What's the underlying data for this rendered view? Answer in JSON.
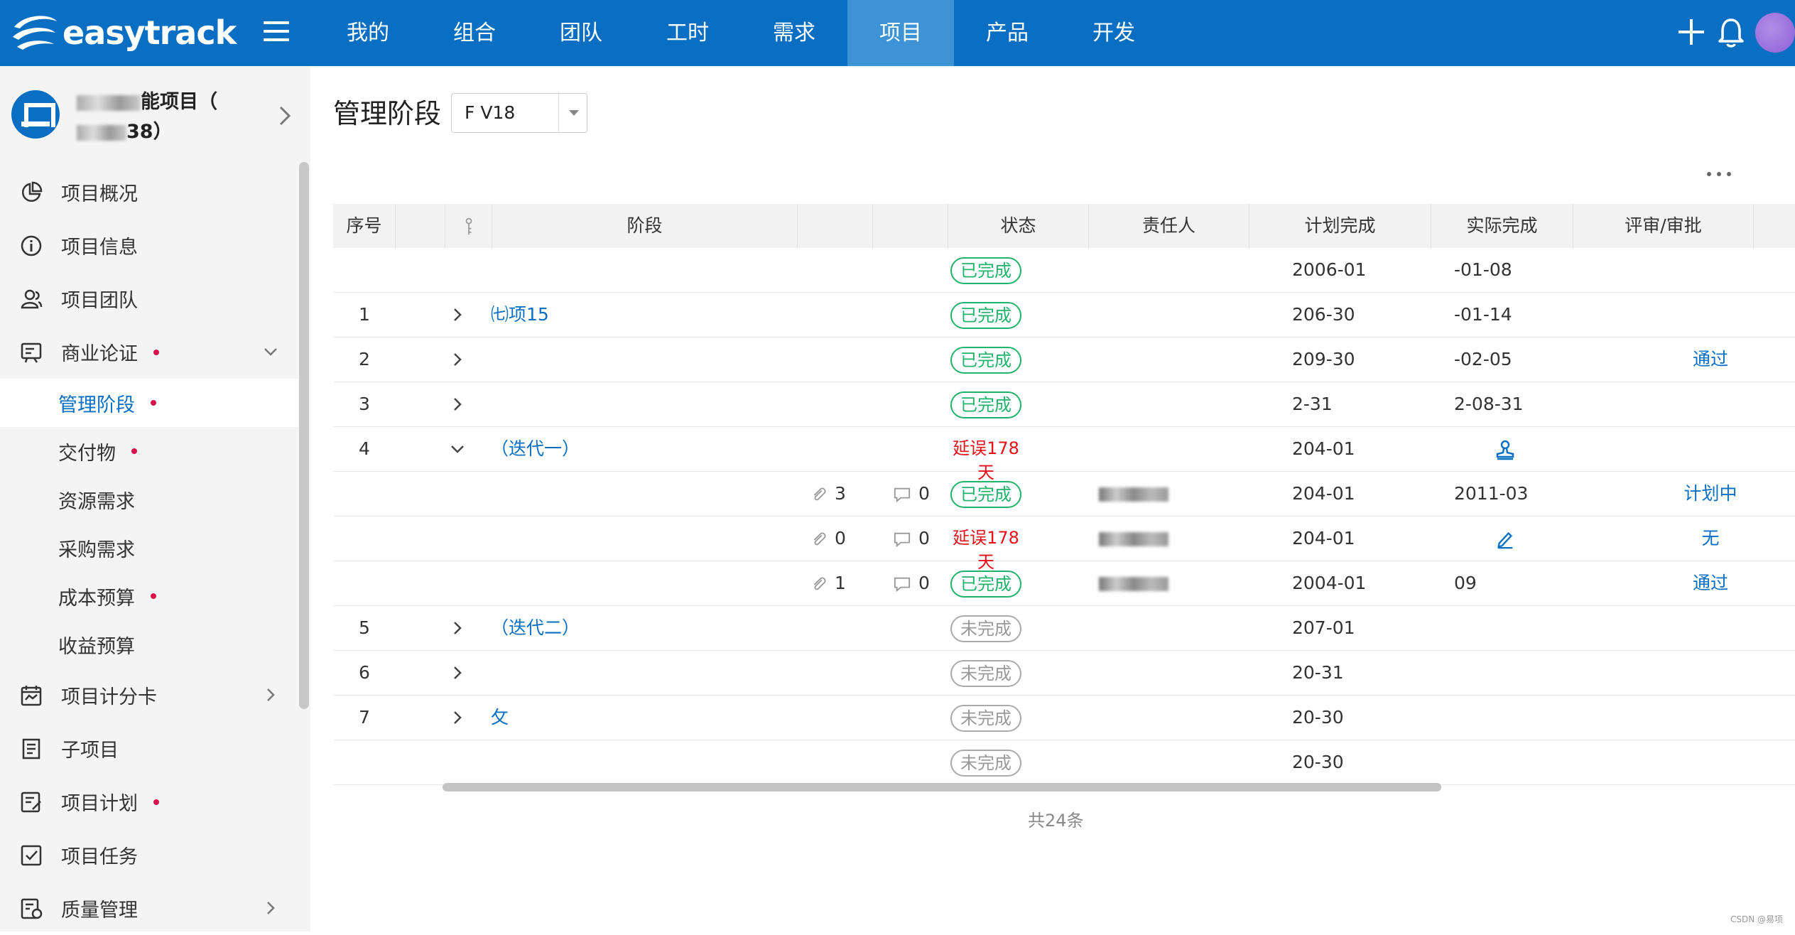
{
  "app": {
    "logo_text": "easytrack",
    "nav": [
      "我的",
      "组合",
      "团队",
      "工时",
      "需求",
      "项目",
      "产品",
      "开发"
    ],
    "active_nav": "项目"
  },
  "sidebar": {
    "project_name_line1": "能项目（",
    "project_name_line2": "38）",
    "menu": [
      {
        "label": "项目概况",
        "icon": "pie-chart-icon"
      },
      {
        "label": "项目信息",
        "icon": "info-icon"
      },
      {
        "label": "项目团队",
        "icon": "team-icon"
      },
      {
        "label": "商业论证",
        "icon": "business-case-icon",
        "dot": true,
        "chevron": "down"
      }
    ],
    "submenu": [
      {
        "label": "管理阶段",
        "dot": true,
        "active": true
      },
      {
        "label": "交付物",
        "dot": true
      },
      {
        "label": "资源需求"
      },
      {
        "label": "采购需求"
      },
      {
        "label": "成本预算",
        "dot": true
      },
      {
        "label": "收益预算"
      }
    ],
    "menu2": [
      {
        "label": "项目计分卡",
        "icon": "scorecard-icon",
        "chevron": "right"
      },
      {
        "label": "子项目",
        "icon": "subproject-icon"
      },
      {
        "label": "项目计划",
        "icon": "plan-icon",
        "dot": true
      },
      {
        "label": "项目任务",
        "icon": "task-icon"
      },
      {
        "label": "质量管理",
        "icon": "quality-icon",
        "chevron": "right"
      }
    ]
  },
  "main": {
    "title": "管理阶段",
    "version_select": "F V18",
    "columns": {
      "no": "序号",
      "stage": "阶段",
      "status": "状态",
      "owner": "责任人",
      "plan": "计划完成",
      "actual": "实际完成",
      "review": "评审/审批"
    },
    "rows": [
      {
        "no": "",
        "expand": "",
        "stage": "",
        "att": "",
        "cmt": "",
        "status": "已完成",
        "status_type": "done",
        "owner": "",
        "plan": "2006-01",
        "actual": "-01-08",
        "review": ""
      },
      {
        "no": "1",
        "expand": "right",
        "stage": "㈦项15",
        "att": "",
        "cmt": "",
        "status": "已完成",
        "status_type": "done",
        "owner": "",
        "plan": "206-30",
        "actual": "-01-14",
        "review": ""
      },
      {
        "no": "2",
        "expand": "right",
        "stage": "",
        "att": "",
        "cmt": "",
        "status": "已完成",
        "status_type": "done",
        "owner": "",
        "plan": "209-30",
        "actual": "-02-05",
        "review": "通过"
      },
      {
        "no": "3",
        "expand": "right",
        "stage": "",
        "att": "",
        "cmt": "",
        "status": "已完成",
        "status_type": "done",
        "owner": "",
        "plan": "2-31",
        "actual": "2-08-31",
        "review": ""
      },
      {
        "no": "4",
        "expand": "down",
        "stage": "（迭代一）",
        "att": "",
        "cmt": "",
        "status": "延误178天",
        "status_type": "late",
        "owner": "",
        "plan": "204-01",
        "actual": "",
        "actual_icon": "stamp",
        "review": ""
      },
      {
        "no": "",
        "expand": "",
        "stage": "",
        "att": "3",
        "cmt": "0",
        "status": "已完成",
        "status_type": "done",
        "owner": "blur",
        "plan": "204-01",
        "actual": "2011-03",
        "review": "计划中"
      },
      {
        "no": "",
        "expand": "",
        "stage": "",
        "att": "0",
        "cmt": "0",
        "status": "延误178天",
        "status_type": "late",
        "owner": "blur",
        "plan": "204-01",
        "actual": "",
        "actual_icon": "edit",
        "review": "无"
      },
      {
        "no": "",
        "expand": "",
        "stage": "",
        "att": "1",
        "cmt": "0",
        "status": "已完成",
        "status_type": "done",
        "owner": "blur",
        "plan": "2004-01",
        "actual": "09",
        "review": "通过"
      },
      {
        "no": "5",
        "expand": "right",
        "stage": "（迭代二）",
        "att": "",
        "cmt": "",
        "status": "未完成",
        "status_type": "todo",
        "owner": "",
        "plan": "207-01",
        "actual": "",
        "review": ""
      },
      {
        "no": "6",
        "expand": "right",
        "stage": "",
        "att": "",
        "cmt": "",
        "status": "未完成",
        "status_type": "todo",
        "owner": "",
        "plan": "20-31",
        "actual": "",
        "review": ""
      },
      {
        "no": "7",
        "expand": "right",
        "stage": "攵",
        "att": "",
        "cmt": "",
        "status": "未完成",
        "status_type": "todo",
        "owner": "",
        "plan": "20-30",
        "actual": "",
        "review": ""
      },
      {
        "no": "",
        "expand": "",
        "stage": "",
        "att": "",
        "cmt": "",
        "status": "未完成",
        "status_type": "todo",
        "owner": "",
        "plan": "20-30",
        "actual": "",
        "review": ""
      }
    ],
    "total": "共24条"
  },
  "watermark": "CSDN @易项",
  "colors": {
    "primary": "#0a6fc2",
    "done": "#1fb36b",
    "late": "#e5101a",
    "dot": "#d9114d"
  }
}
